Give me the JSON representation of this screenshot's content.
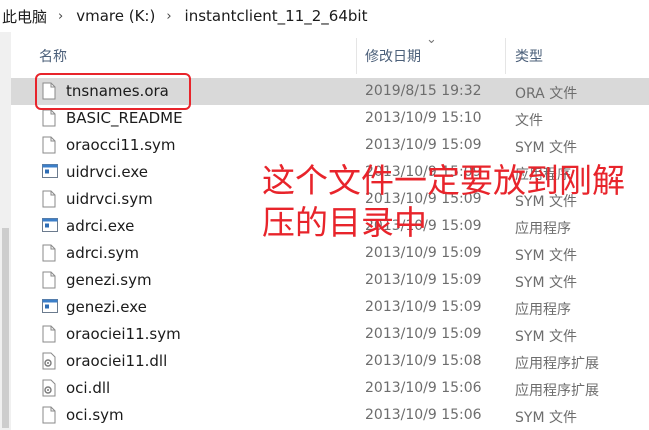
{
  "breadcrumb": [
    "此电脑",
    "vmare (K:)",
    "instantclient_11_2_64bit"
  ],
  "header": {
    "name": "名称",
    "date": "修改日期",
    "type": "类型"
  },
  "files": [
    {
      "name": "tnsnames.ora",
      "date": "2019/8/15 19:32",
      "type": "ORA 文件",
      "icon": "document-icon",
      "selected": true
    },
    {
      "name": "BASIC_README",
      "date": "2013/10/9 15:10",
      "type": "文件",
      "icon": "document-icon"
    },
    {
      "name": "oraocci11.sym",
      "date": "2013/10/9 15:09",
      "type": "SYM 文件",
      "icon": "document-icon"
    },
    {
      "name": "uidrvci.exe",
      "date": "2013/10/9 15:09",
      "type": "应用程序",
      "icon": "application-icon"
    },
    {
      "name": "uidrvci.sym",
      "date": "2013/10/9 15:09",
      "type": "SYM 文件",
      "icon": "document-icon"
    },
    {
      "name": "adrci.exe",
      "date": "2013/10/9 15:09",
      "type": "应用程序",
      "icon": "application-icon"
    },
    {
      "name": "adrci.sym",
      "date": "2013/10/9 15:09",
      "type": "SYM 文件",
      "icon": "document-icon"
    },
    {
      "name": "genezi.sym",
      "date": "2013/10/9 15:09",
      "type": "SYM 文件",
      "icon": "document-icon"
    },
    {
      "name": "genezi.exe",
      "date": "2013/10/9 15:09",
      "type": "应用程序",
      "icon": "application-icon"
    },
    {
      "name": "oraociei11.sym",
      "date": "2013/10/9 15:09",
      "type": "SYM 文件",
      "icon": "document-icon"
    },
    {
      "name": "oraociei11.dll",
      "date": "2013/10/9 15:08",
      "type": "应用程序扩展",
      "icon": "dll-icon"
    },
    {
      "name": "oci.dll",
      "date": "2013/10/9 15:06",
      "type": "应用程序扩展",
      "icon": "dll-icon"
    },
    {
      "name": "oci.sym",
      "date": "2013/10/9 15:06",
      "type": "SYM 文件",
      "icon": "document-icon"
    }
  ],
  "annotation": [
    "这个文件一定要放到刚解",
    "压的目录中"
  ],
  "colors": {
    "annotation": "#e8242b",
    "selected_row": "#d9d9d9",
    "header_text": "#4c607a"
  }
}
